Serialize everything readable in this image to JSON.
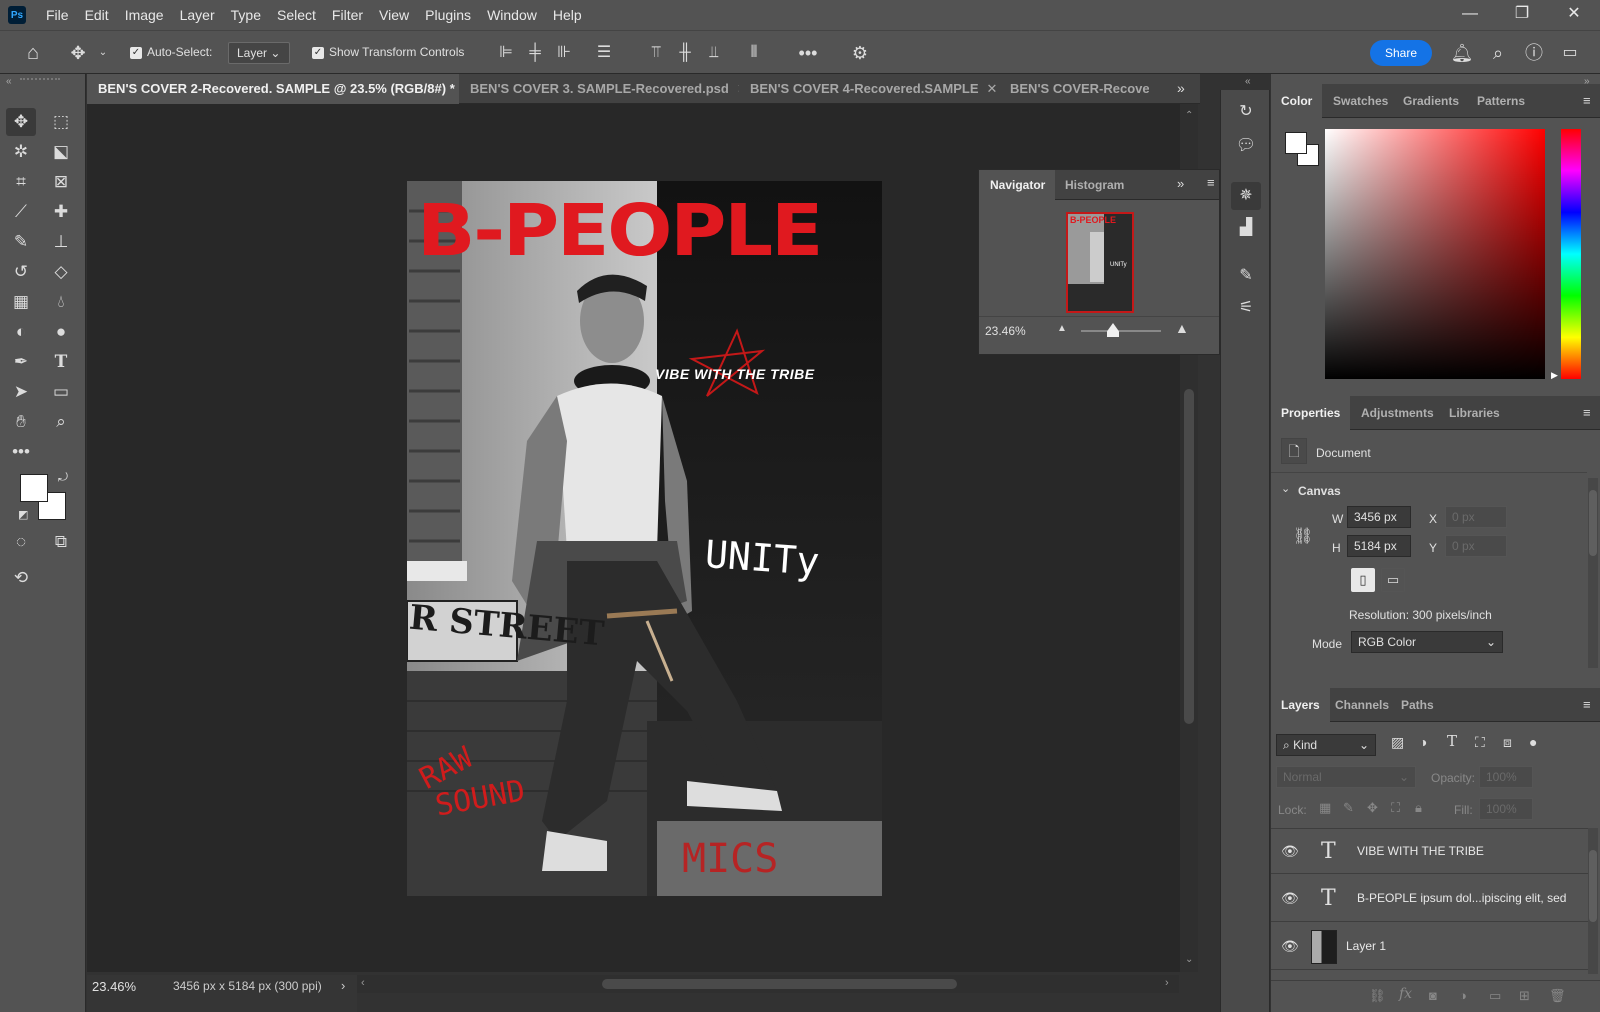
{
  "app": {
    "logo": "Ps"
  },
  "menu": [
    "File",
    "Edit",
    "Image",
    "Layer",
    "Type",
    "Select",
    "Filter",
    "View",
    "Plugins",
    "Window",
    "Help"
  ],
  "options": {
    "auto_select_label": "Auto-Select:",
    "auto_select_value": "Layer",
    "show_transform_label": "Show Transform Controls",
    "share_label": "Share"
  },
  "tabs": [
    {
      "label": "BEN'S COVER 2-Recovered. SAMPLE  @ 23.5% (RGB/8#) *",
      "active": true
    },
    {
      "label": "BEN'S COVER 3. SAMPLE-Recovered.psd",
      "active": false
    },
    {
      "label": "BEN'S COVER 4-Recovered.SAMPLE",
      "active": false
    },
    {
      "label": "BEN'S COVER-Recovere",
      "active": false
    }
  ],
  "poster": {
    "title": "B-PEOPLE",
    "tagline": "VIBE WITH THE TRIBE",
    "unity": "UNITy",
    "raw": "RAW",
    "sound": "SOUND",
    "mics": "MICS",
    "street": "R STREET",
    "accent": "#e0191f"
  },
  "navigator": {
    "tab_active": "Navigator",
    "tab_other": "Histogram",
    "zoom": "23.46%",
    "thumb_title": "B-PEOPLE",
    "thumb_text": "UNITy"
  },
  "color_panel": {
    "tabs": [
      "Color",
      "Swatches",
      "Gradients",
      "Patterns"
    ]
  },
  "properties": {
    "tabs": [
      "Properties",
      "Adjustments",
      "Libraries"
    ],
    "document_label": "Document",
    "canvas_label": "Canvas",
    "w_label": "W",
    "w_value": "3456 px",
    "h_label": "H",
    "h_value": "5184 px",
    "x_label": "X",
    "x_value": "0 px",
    "y_label": "Y",
    "y_value": "0 px",
    "resolution": "Resolution: 300 pixels/inch",
    "mode_label": "Mode",
    "mode_value": "RGB Color"
  },
  "layers": {
    "tabs": [
      "Layers",
      "Channels",
      "Paths"
    ],
    "kind_label": "Kind",
    "blend_mode": "Normal",
    "opacity_label": "Opacity:",
    "opacity_value": "100%",
    "lock_label": "Lock:",
    "fill_label": "Fill:",
    "fill_value": "100%",
    "items": [
      {
        "name": "VIBE WITH THE TRIBE",
        "type": "text"
      },
      {
        "name": "B-PEOPLE ipsum dol...ipiscing elit, sed",
        "type": "text"
      },
      {
        "name": "Layer 1",
        "type": "pixel"
      }
    ]
  },
  "status": {
    "zoom": "23.46%",
    "size": "3456 px x 5184 px (300 ppi)"
  }
}
